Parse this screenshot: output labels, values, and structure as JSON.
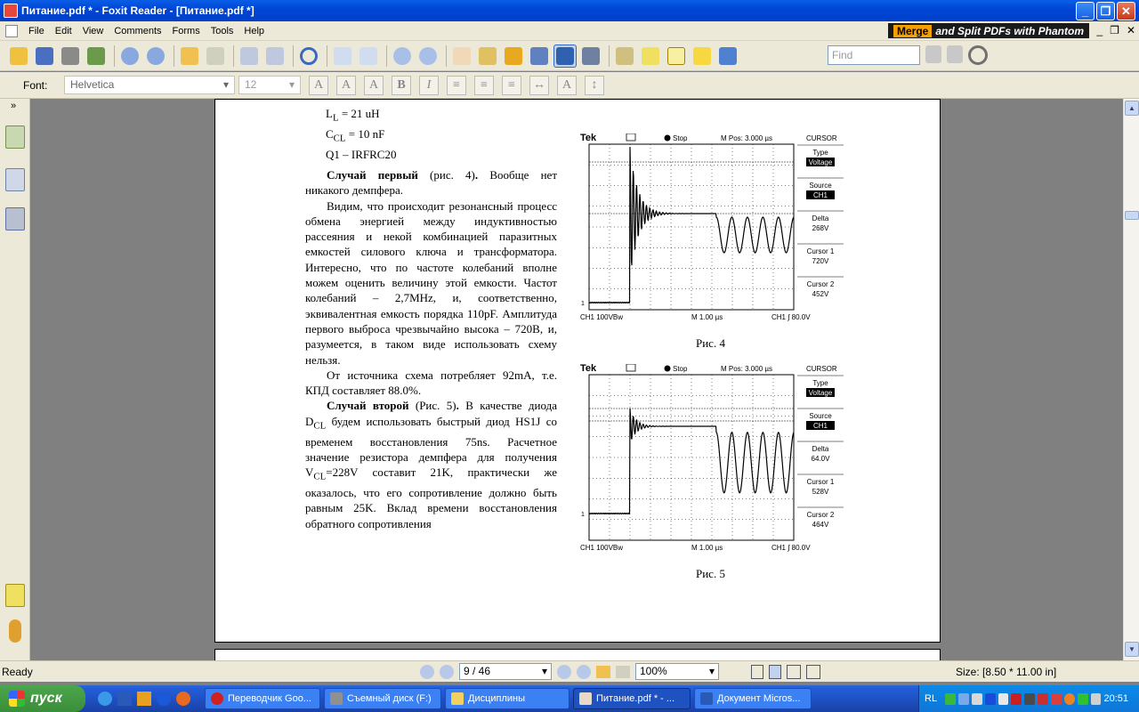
{
  "window": {
    "title": "Питание.pdf * - Foxit Reader - [Питание.pdf *]",
    "min": "_",
    "max": "❐",
    "close": "✕"
  },
  "menu": {
    "items": [
      "File",
      "Edit",
      "View",
      "Comments",
      "Forms",
      "Tools",
      "Help"
    ],
    "banner_merge": "Merge",
    "banner_rest": "and Split PDFs with Phantom",
    "mdi": [
      "_",
      "❐",
      "✕"
    ]
  },
  "toolbar": {
    "find_placeholder": "Find"
  },
  "format": {
    "font_label": "Font:",
    "font_value": "Helvetica",
    "size_value": "12",
    "buttons": [
      "A",
      "A",
      "A",
      "B",
      "I"
    ]
  },
  "document": {
    "list_lines": [
      "L<sub>L</sub> = 21 uH",
      "C<sub>CL</sub> = 10 nF",
      "Q1 – IRFRC20"
    ],
    "paragraphs": [
      "<b>Случай первый</b> (рис. 4)<b>.</b> Вообще нет никакого демпфера.",
      "Видим, что происходит резонансный процесс обмена энергией между индуктивностью рассеяния и некой комбинацией паразитных емкостей силового ключа и трансформатора. Интересно, что по частоте колебаний вполне можем оценить величину этой емкости. Частот колебаний – 2,7MHz, и, соответственно, эквивалентная емкость порядка 110pF. Амплитуда первого выброса чрезвычайно высока – 720В, и, разумеется, в таком виде использовать схему нельзя.",
      "От источника схема потребляет 92mA, т.е. КПД составляет 88.0%.",
      "<b>Случай второй</b> (Рис. 5)<b>.</b> В качестве диода D<sub>CL</sub> будем использовать быстрый диод HS1J со временем восстановления 75ns. Расчетное значение резистора демпфера для получения V<sub>CL</sub>=228V составит 21K, практически же оказалось, что его сопротивление должно быть равным 25K. Вклад времени восстановления обратного сопротивления"
    ],
    "scopes": [
      {
        "caption": "Рис. 4",
        "brand": "Tek",
        "stop": "Stop",
        "mpos": "M Pos: 3.000 µs",
        "menu": "CURSOR",
        "type_label": "Type",
        "type_value": "Voltage",
        "source_label": "Source",
        "source_value": "CH1",
        "delta_label": "Delta",
        "delta_value": "268V",
        "c1_label": "Cursor 1",
        "c1_value": "720V",
        "c2_label": "Cursor 2",
        "c2_value": "452V",
        "bot_ch": "CH1  100VBw",
        "bot_m": "M 1.00 µs",
        "bot_trig": "CH1 ∫ 80.0V"
      },
      {
        "caption": "Рис. 5",
        "brand": "Tek",
        "stop": "Stop",
        "mpos": "M Pos: 3.000 µs",
        "menu": "CURSOR",
        "type_label": "Type",
        "type_value": "Voltage",
        "source_label": "Source",
        "source_value": "CH1",
        "delta_label": "Delta",
        "delta_value": "64.0V",
        "c1_label": "Cursor 1",
        "c1_value": "528V",
        "c2_label": "Cursor 2",
        "c2_value": "464V",
        "bot_ch": "CH1  100VBw",
        "bot_m": "M 1.00 µs",
        "bot_trig": "CH1 ∫ 80.0V"
      }
    ]
  },
  "status": {
    "ready": "Ready",
    "page": "9 / 46",
    "zoom": "100%",
    "size": "Size: [8.50 * 11.00 in]"
  },
  "taskbar": {
    "start": "пуск",
    "tasks": [
      "Переводчик Goo...",
      "Съемный диск (F:)",
      "Дисциплины",
      "Питание.pdf * - ...",
      "Документ Micros..."
    ],
    "lang": "RL",
    "clock": "20:51"
  }
}
